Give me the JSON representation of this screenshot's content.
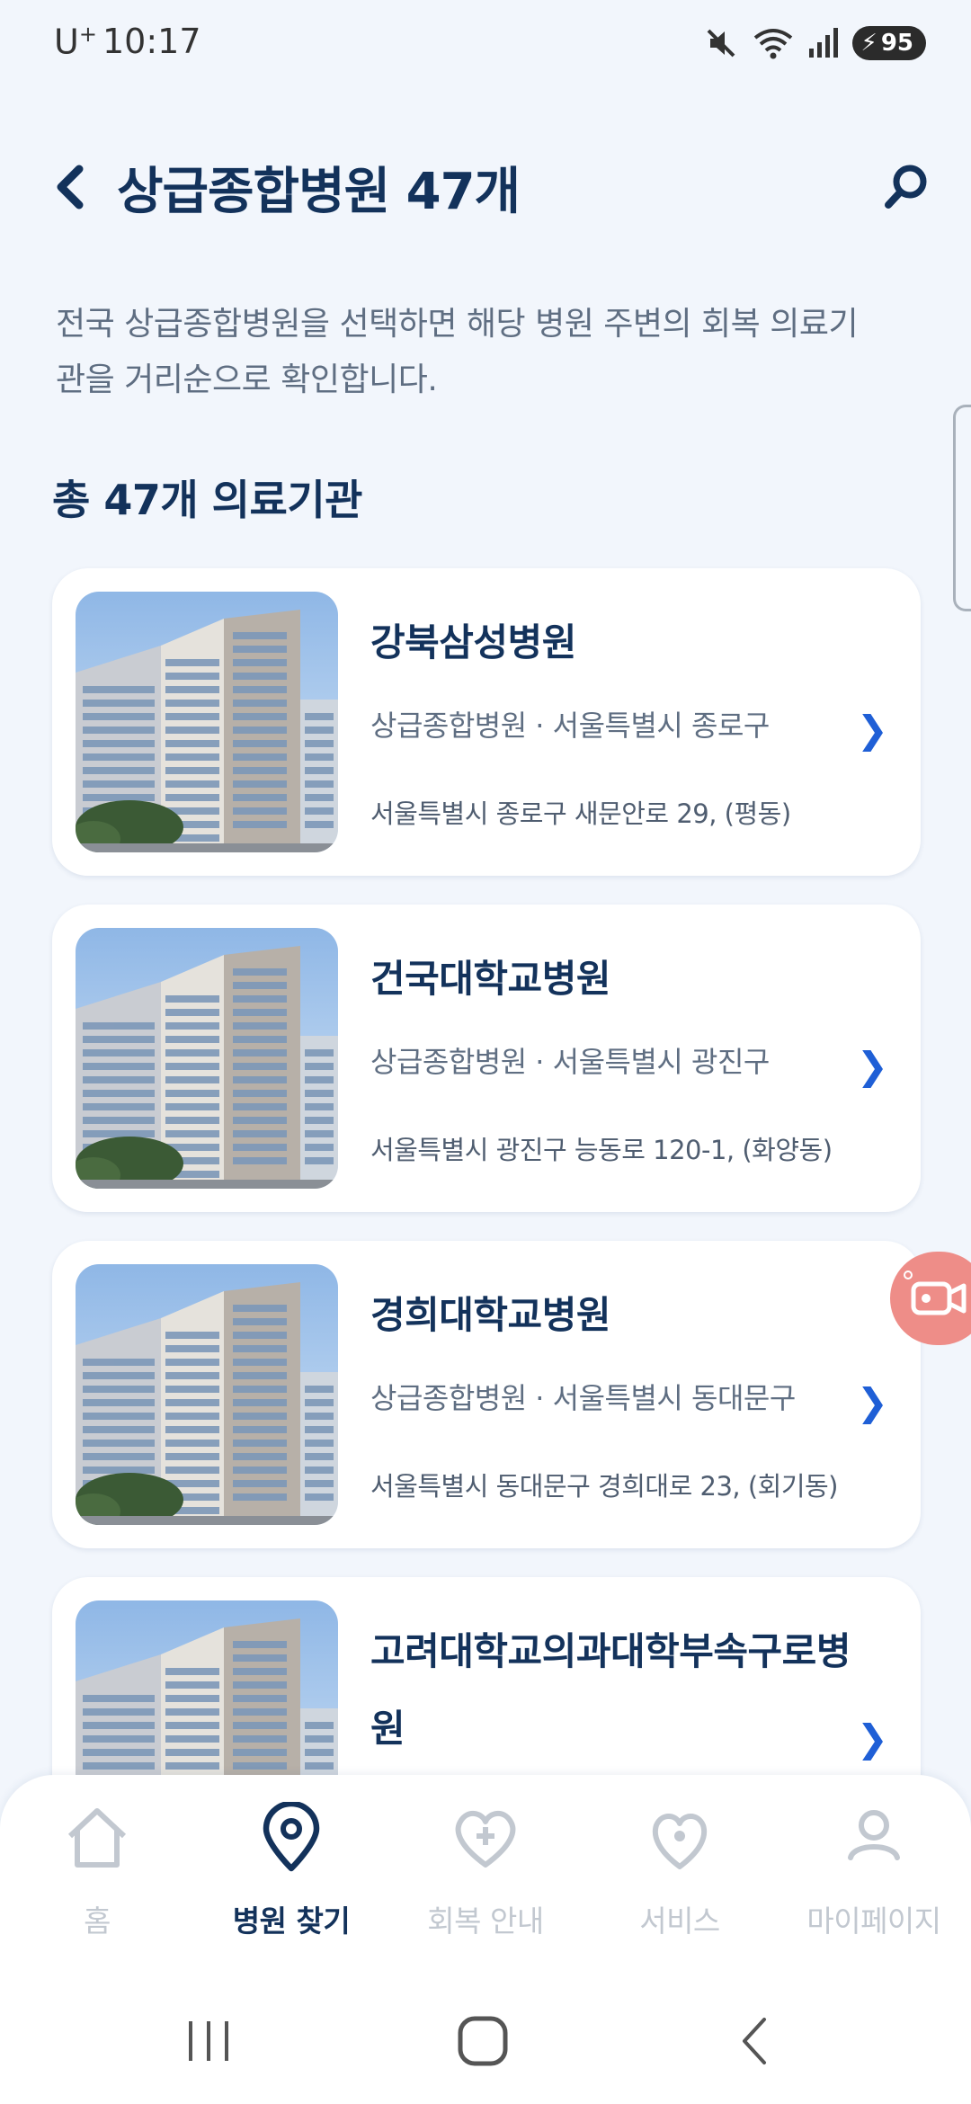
{
  "status_bar": {
    "carrier": "U",
    "carrier_sup": "+",
    "time": "10:17",
    "battery": "95"
  },
  "header": {
    "title": "상급종합병원 47개"
  },
  "description": "전국 상급종합병원을 선택하면 해당 병원 주변의 회복 의료기관을 거리순으로 확인합니다.",
  "count_heading": "총 47개 의료기관",
  "hospitals": [
    {
      "name": "강북삼성병원",
      "meta": "상급종합병원 · 서울특별시 종로구",
      "address": "서울특별시 종로구 새문안로 29, (평동)"
    },
    {
      "name": "건국대학교병원",
      "meta": "상급종합병원 · 서울특별시 광진구",
      "address": "서울특별시 광진구 능동로 120-1, (화양동)"
    },
    {
      "name": "경희대학교병원",
      "meta": "상급종합병원 · 서울특별시 동대문구",
      "address": "서울특별시 동대문구 경희대로 23, (회기동)"
    },
    {
      "name": "고려대학교의과대학부속구로병원",
      "meta": "",
      "address": ""
    }
  ],
  "bottom_nav": [
    {
      "label": "홈",
      "icon": "home-icon"
    },
    {
      "label": "병원 찾기",
      "icon": "location-pin-icon"
    },
    {
      "label": "회복 안내",
      "icon": "heart-plus-icon"
    },
    {
      "label": "서비스",
      "icon": "heart-icon"
    },
    {
      "label": "마이페이지",
      "icon": "user-icon"
    }
  ],
  "colors": {
    "background": "#f2f6fc",
    "title": "#13325b",
    "accent_blue": "#1f5fd6",
    "inactive_nav": "#c2c8d0",
    "float_button": "#ee8d88"
  }
}
